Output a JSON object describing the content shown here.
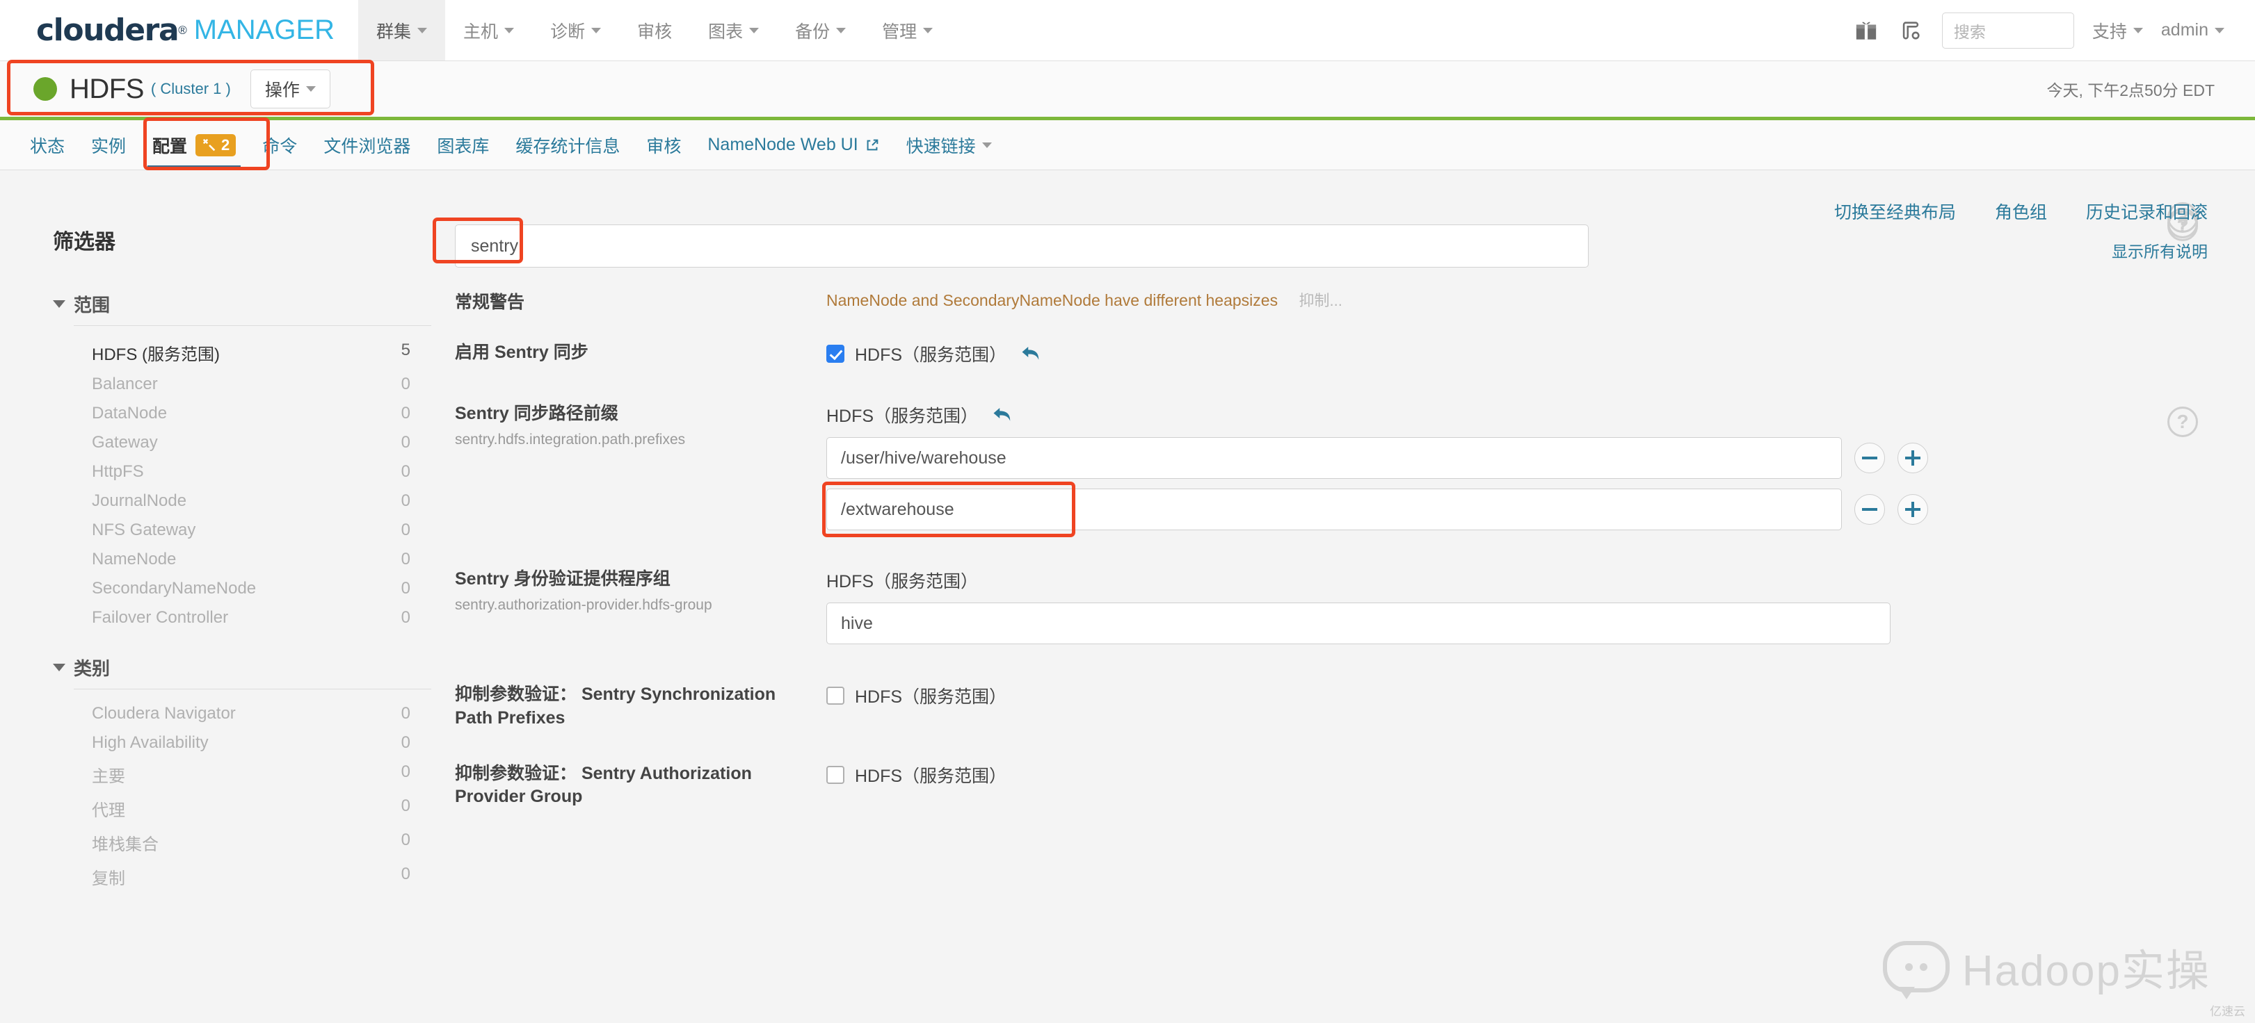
{
  "topbar": {
    "brand": {
      "primary": "cloudera",
      "reg": "®",
      "secondary": "MANAGER"
    },
    "nav": [
      {
        "label": "群集",
        "caret": true,
        "active": true
      },
      {
        "label": "主机",
        "caret": true,
        "active": false
      },
      {
        "label": "诊断",
        "caret": true,
        "active": false
      },
      {
        "label": "审核",
        "caret": false,
        "active": false
      },
      {
        "label": "图表",
        "caret": true,
        "active": false
      },
      {
        "label": "备份",
        "caret": true,
        "active": false
      },
      {
        "label": "管理",
        "caret": true,
        "active": false
      }
    ],
    "search_placeholder": "搜索",
    "support_label": "支持",
    "user_label": "admin"
  },
  "service_header": {
    "name": "HDFS",
    "cluster": "( Cluster 1 )",
    "action_button": "操作",
    "timestamp": "今天, 下午2点50分 EDT",
    "status_color": "#6aa62b"
  },
  "tabs": [
    {
      "label": "状态",
      "active": false
    },
    {
      "label": "实例",
      "active": false
    },
    {
      "label": "配置",
      "active": true,
      "badge": "2"
    },
    {
      "label": "命令",
      "active": false
    },
    {
      "label": "文件浏览器",
      "active": false
    },
    {
      "label": "图表库",
      "active": false
    },
    {
      "label": "缓存统计信息",
      "active": false
    },
    {
      "label": "审核",
      "active": false
    },
    {
      "label": "NameNode Web UI",
      "active": false,
      "external": true
    },
    {
      "label": "快速链接",
      "active": false,
      "caret": true
    }
  ],
  "toolbar_links": [
    "切换至经典布局",
    "角色组",
    "历史记录和回滚"
  ],
  "sidebar": {
    "title": "筛选器",
    "facets": [
      {
        "name": "范围",
        "items": [
          {
            "label": "HDFS (服务范围)",
            "count": "5",
            "selected": true
          },
          {
            "label": "Balancer",
            "count": "0",
            "selected": false
          },
          {
            "label": "DataNode",
            "count": "0",
            "selected": false
          },
          {
            "label": "Gateway",
            "count": "0",
            "selected": false
          },
          {
            "label": "HttpFS",
            "count": "0",
            "selected": false
          },
          {
            "label": "JournalNode",
            "count": "0",
            "selected": false
          },
          {
            "label": "NFS Gateway",
            "count": "0",
            "selected": false
          },
          {
            "label": "NameNode",
            "count": "0",
            "selected": false
          },
          {
            "label": "SecondaryNameNode",
            "count": "0",
            "selected": false
          },
          {
            "label": "Failover Controller",
            "count": "0",
            "selected": false
          }
        ]
      },
      {
        "name": "类别",
        "items": [
          {
            "label": "Cloudera Navigator",
            "count": "0",
            "selected": false
          },
          {
            "label": "High Availability",
            "count": "0",
            "selected": false
          },
          {
            "label": "主要",
            "count": "0",
            "selected": false
          },
          {
            "label": "代理",
            "count": "0",
            "selected": false
          },
          {
            "label": "堆栈集合",
            "count": "0",
            "selected": false
          },
          {
            "label": "复制",
            "count": "0",
            "selected": false
          }
        ]
      }
    ]
  },
  "main": {
    "filter_value": "sentry",
    "show_all_label": "显示所有说明",
    "warning": {
      "label": "常规警告",
      "text": "NameNode and SecondaryNameNode have different heapsizes",
      "suppress_link": "抑制..."
    },
    "scope_label": "HDFS（服务范围）",
    "rows": [
      {
        "name": "启用 Sentry 同步",
        "prop": "",
        "type": "checkbox",
        "checked": true,
        "undo": true,
        "help": "?"
      },
      {
        "name": "Sentry 同步路径前缀",
        "prop": "sentry.hdfs.integration.path.prefixes",
        "type": "multi-text",
        "undo": true,
        "values": [
          "/user/hive/warehouse",
          "/extwarehouse"
        ],
        "help": "?"
      },
      {
        "name": "Sentry 身份验证提供程序组",
        "prop": "sentry.authorization-provider.hdfs-group",
        "type": "text",
        "undo": false,
        "values": [
          "hive"
        ],
        "help": "?"
      },
      {
        "name": "抑制参数验证： Sentry Synchronization Path Prefixes",
        "prop": "",
        "type": "checkbox",
        "checked": false,
        "undo": false,
        "help": "?"
      },
      {
        "name": "抑制参数验证： Sentry Authorization Provider Group",
        "prop": "",
        "type": "checkbox",
        "checked": false,
        "undo": false,
        "help": "?"
      }
    ]
  },
  "watermark": {
    "text": "Hadoop实操",
    "corner": "亿速云"
  },
  "colors": {
    "accent_link": "#2b7a9b",
    "brand_blue": "#33b5e5",
    "brand_navy": "#1f3a52",
    "status_green": "#6aa62b",
    "annotation_red": "#ef4422",
    "badge_orange": "#e8a020",
    "warning_text": "#b07a3a"
  }
}
